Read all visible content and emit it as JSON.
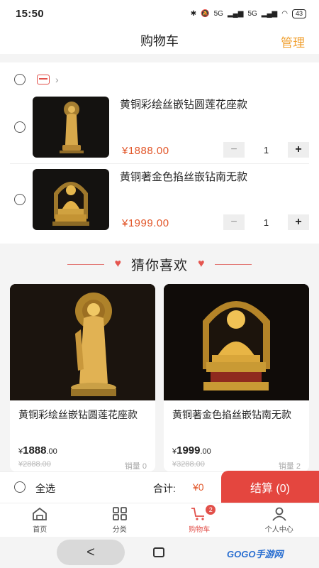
{
  "status": {
    "time": "15:50",
    "signal1": "5G",
    "signal2": "5G",
    "battery": "43"
  },
  "header": {
    "title": "购物车",
    "manage": "管理"
  },
  "cart": {
    "items": [
      {
        "name": "黄铜彩绘丝嵌钻圆莲花座款",
        "price": "¥1888.00",
        "qty": "1"
      },
      {
        "name": "黄铜著金色掐丝嵌钻南无款",
        "price": "¥1999.00",
        "qty": "1"
      }
    ]
  },
  "guess": {
    "title": "猜你喜欢"
  },
  "recommendations": [
    {
      "name": "黄铜彩绘丝嵌钻圆莲花座款",
      "currency": "¥",
      "price_int": "1888",
      "price_dec": ".00",
      "old_price": "¥2888.00",
      "sales": "销量 0"
    },
    {
      "name": "黄铜著金色掐丝嵌钻南无款",
      "currency": "¥",
      "price_int": "1999",
      "price_dec": ".00",
      "old_price": "¥3288.00",
      "sales": "销量 2"
    }
  ],
  "checkout": {
    "select_all": "全选",
    "total_label": "合计:",
    "total_value": "¥0",
    "button": "结算 (0)"
  },
  "tabs": [
    {
      "label": "首页",
      "icon": "home-icon"
    },
    {
      "label": "分类",
      "icon": "grid-icon"
    },
    {
      "label": "购物车",
      "icon": "cart-icon",
      "badge": "2"
    },
    {
      "label": "个人中心",
      "icon": "person-icon"
    }
  ],
  "nav": {
    "back": "<"
  },
  "watermark": "GOGO手游网",
  "colors": {
    "accent": "#e2504a",
    "manage": "#f0a030",
    "price": "#e2572a"
  }
}
